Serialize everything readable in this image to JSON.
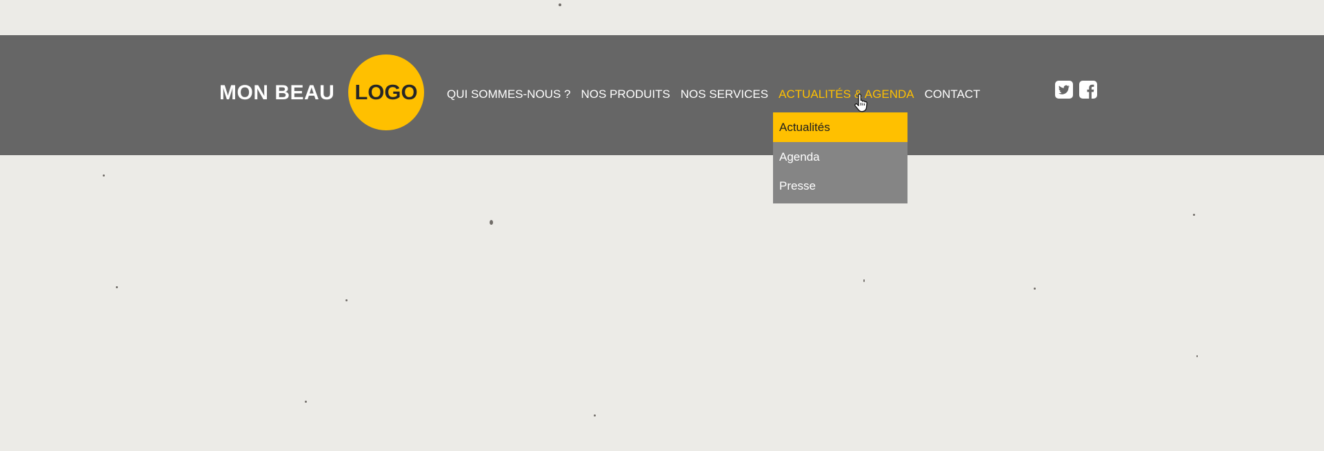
{
  "brand": {
    "text": "MON BEAU",
    "logo_text": "LOGO"
  },
  "nav": {
    "items": [
      {
        "label": "QUI SOMMES-NOUS ?",
        "active": false
      },
      {
        "label": "NOS PRODUITS",
        "active": false
      },
      {
        "label": "NOS SERVICES",
        "active": false
      },
      {
        "label": "ACTUALITÉS & AGENDA",
        "active": true
      },
      {
        "label": "CONTACT",
        "active": false
      }
    ]
  },
  "dropdown": {
    "items": [
      {
        "label": "Actualités",
        "highlighted": true
      },
      {
        "label": "Agenda",
        "highlighted": false
      },
      {
        "label": "Presse",
        "highlighted": false
      }
    ]
  },
  "social": {
    "icons": [
      "twitter-icon",
      "facebook-icon"
    ]
  },
  "colors": {
    "accent": "#ffc000",
    "header_bg": "#666666",
    "dropdown_bg": "#858585",
    "page_bg": "#ecebe7"
  }
}
